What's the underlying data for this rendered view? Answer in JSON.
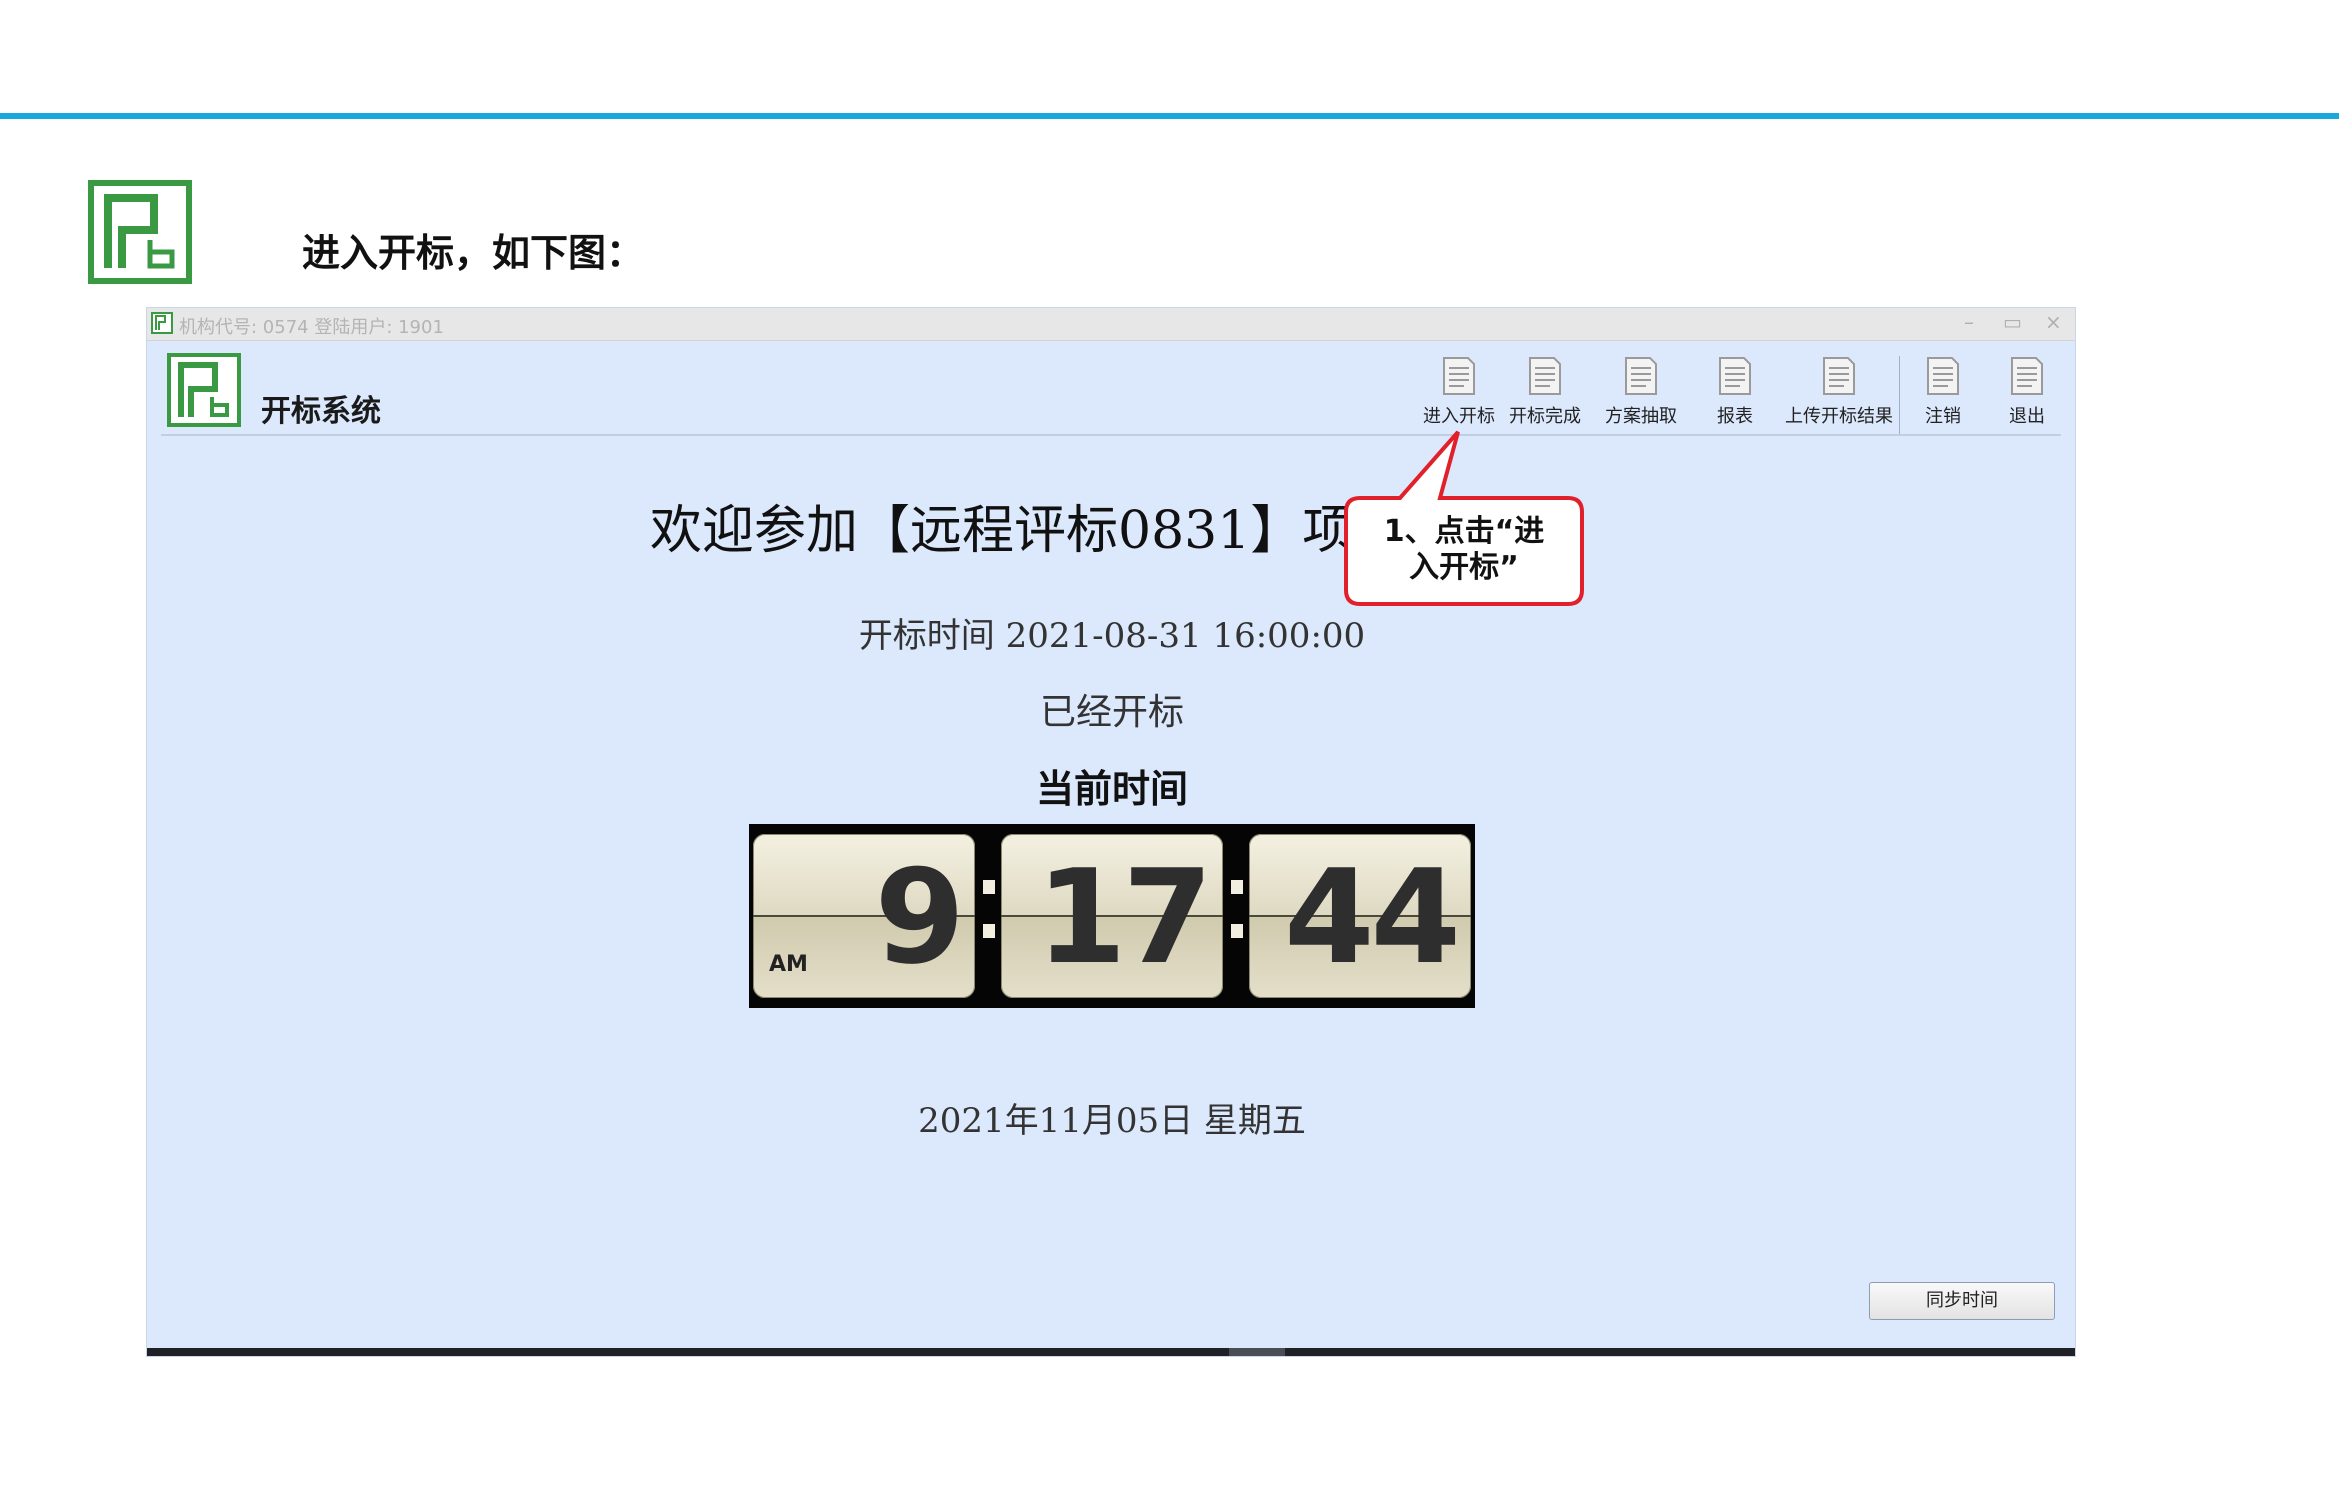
{
  "slide": {
    "heading": "进入开标，如下图："
  },
  "window": {
    "title_text": "机构代号: 0574 登陆用户: 1901",
    "controls": [
      "–",
      "▭",
      "×"
    ]
  },
  "app": {
    "title": "开标系统",
    "toolbar": [
      {
        "label": "进入开标",
        "icon": "document-icon"
      },
      {
        "label": "开标完成",
        "icon": "document-icon"
      },
      {
        "label": "方案抽取",
        "icon": "document-icon"
      },
      {
        "label": "报表",
        "icon": "document-icon"
      },
      {
        "label": "上传开标结果",
        "icon": "document-icon"
      },
      {
        "label": "注销",
        "icon": "document-icon"
      },
      {
        "label": "退出",
        "icon": "document-icon"
      }
    ]
  },
  "main": {
    "welcome": "欢迎参加【远程评标0831】项",
    "open_time": "开标时间 2021-08-31 16:00:00",
    "status": "已经开标",
    "current_time_label": "当前时间",
    "clock": {
      "ampm": "AM",
      "hour": "9",
      "minute": "17",
      "second": "44"
    },
    "date": "2021年11月05日 星期五",
    "sync_button": "同步时间"
  },
  "callout": {
    "text_line1": "1、点击“进",
    "text_line2": "入开标”",
    "border_color": "#e0202a"
  },
  "colors": {
    "accent_rule": "#18a7de",
    "logo_green": "#3a9a44",
    "window_bg": "#dce8fc"
  }
}
